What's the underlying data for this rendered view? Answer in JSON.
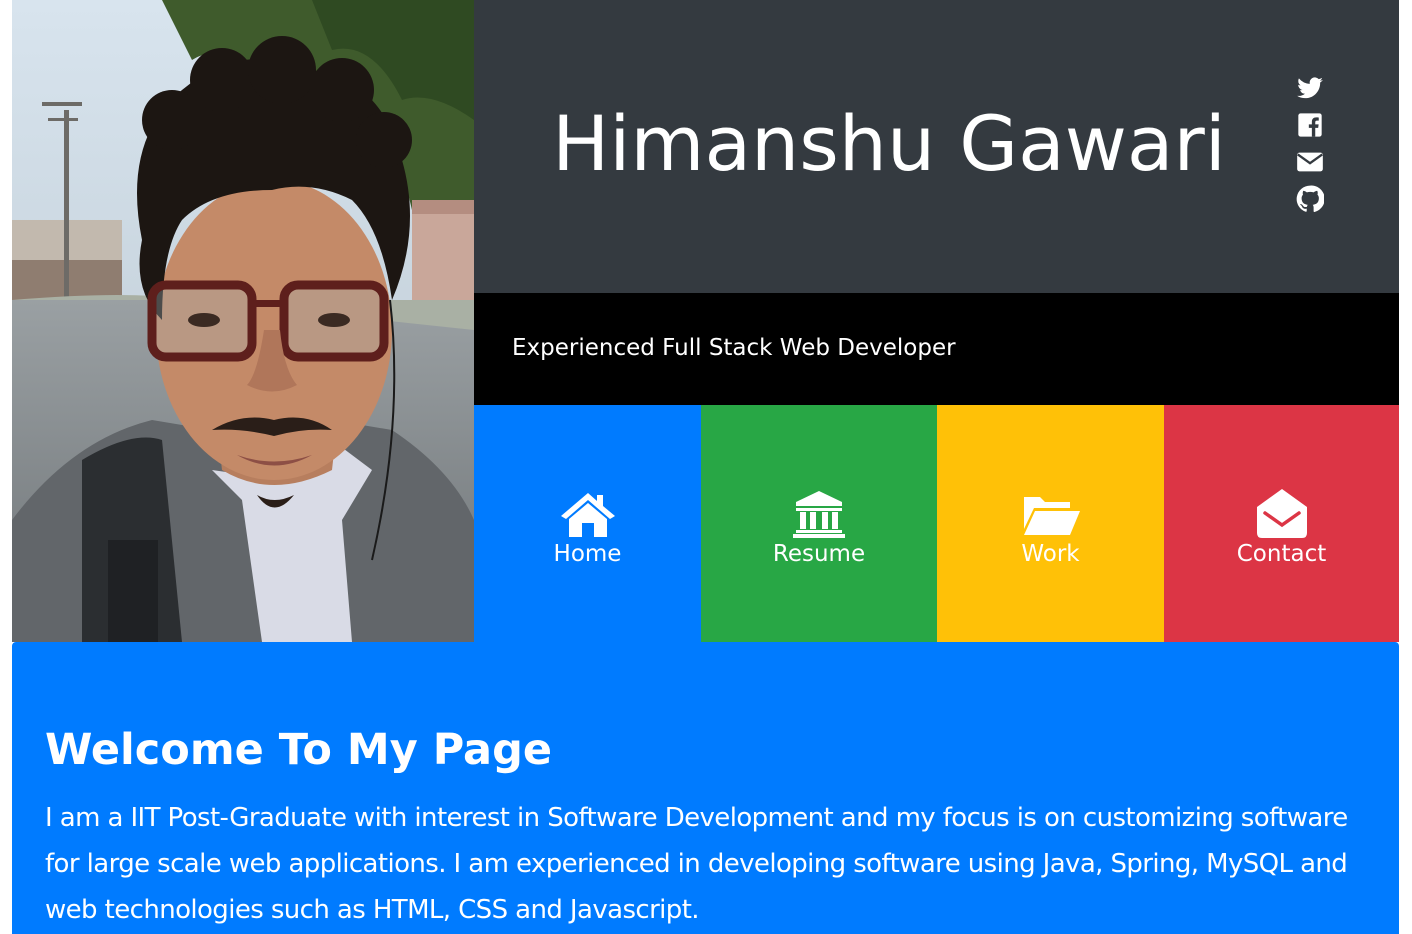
{
  "header": {
    "name": "Himanshu Gawari",
    "tagline": "Experienced Full Stack Web Developer",
    "social": [
      {
        "icon": "twitter-icon"
      },
      {
        "icon": "facebook-icon"
      },
      {
        "icon": "envelope-icon"
      },
      {
        "icon": "github-icon"
      }
    ]
  },
  "nav": {
    "tiles": [
      {
        "label": "Home",
        "icon": "home-icon",
        "color": "#007bff"
      },
      {
        "label": "Resume",
        "icon": "bank-icon",
        "color": "#28a745"
      },
      {
        "label": "Work",
        "icon": "folder-open-icon",
        "color": "#ffc107"
      },
      {
        "label": "Contact",
        "icon": "envelope-open-icon",
        "color": "#dc3545"
      }
    ]
  },
  "welcome": {
    "title": "Welcome To My Page",
    "body": "I am a IIT Post-Graduate with interest in Software Development and my focus is on customizing software for large scale web applications. I am experienced in developing software using Java, Spring, MySQL and web technologies such as HTML, CSS and Javascript."
  },
  "colors": {
    "header_bg": "#343a40",
    "tagline_bg": "#000000",
    "welcome_bg": "#007bff"
  }
}
